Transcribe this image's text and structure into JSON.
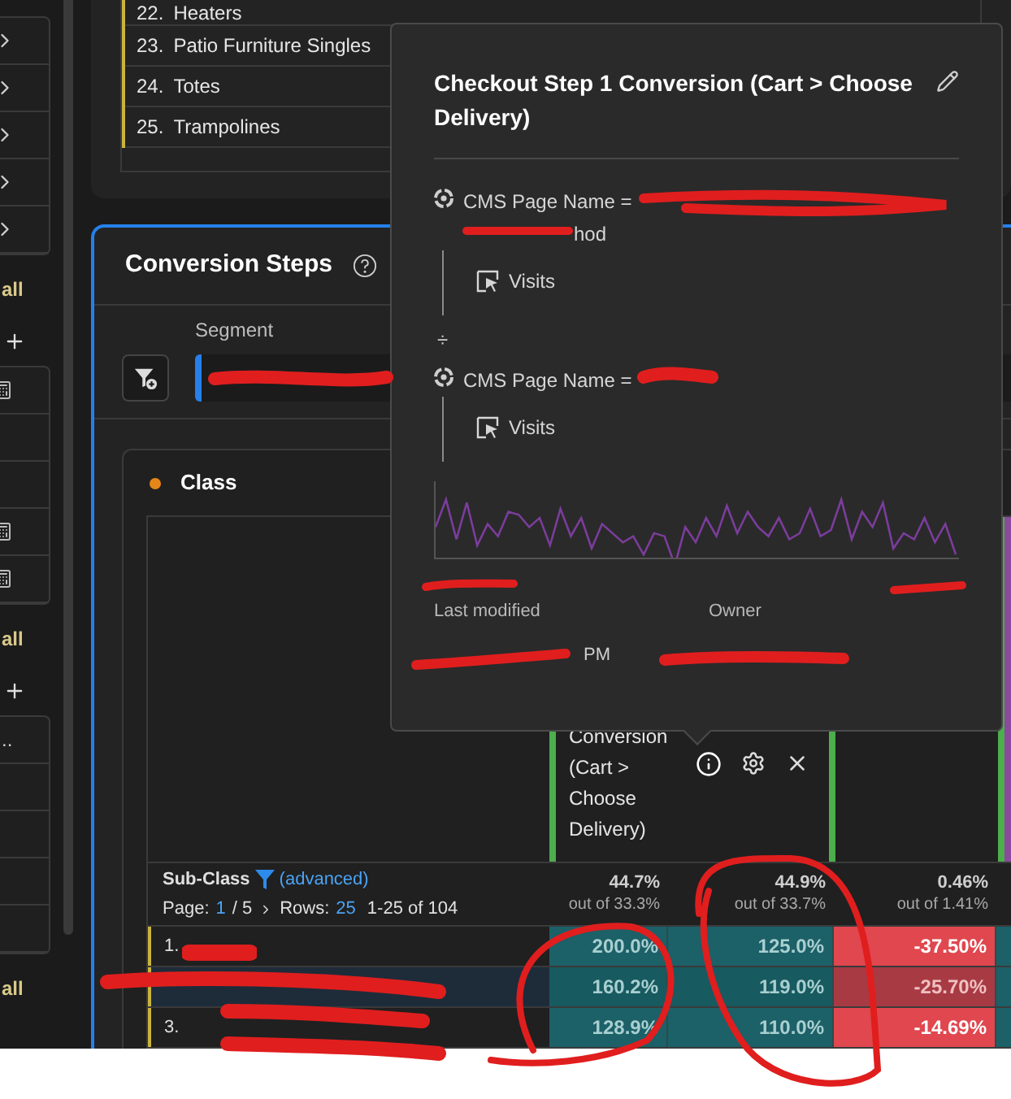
{
  "sidebar": {
    "groups": [
      {
        "rows": [
          {
            "kind": "chevron"
          },
          {
            "kind": "chevron"
          },
          {
            "kind": "chevron"
          },
          {
            "kind": "chevron"
          },
          {
            "kind": "chevron"
          }
        ],
        "link": "all"
      },
      {
        "rows": [
          {
            "kind": "calculator"
          },
          {
            "kind": "blank"
          },
          {
            "kind": "blank"
          },
          {
            "kind": "calculator"
          },
          {
            "kind": "calculator"
          }
        ],
        "link": "all"
      },
      {
        "rows": [
          {
            "kind": "text",
            "text": ".."
          },
          {
            "kind": "blank"
          },
          {
            "kind": "blank"
          },
          {
            "kind": "blank"
          },
          {
            "kind": "blank"
          }
        ],
        "link": "all"
      }
    ]
  },
  "top_list": {
    "rows": [
      {
        "number": "22.",
        "label": "Heaters"
      },
      {
        "number": "23.",
        "label": "Patio Furniture Singles"
      },
      {
        "number": "24.",
        "label": "Totes"
      },
      {
        "number": "25.",
        "label": "Trampolines"
      }
    ]
  },
  "panel": {
    "title": "Conversion Steps",
    "segment_label": "Segment",
    "class_title": "Class"
  },
  "table": {
    "column_header": "Conversion (Cart > Choose Delivery)",
    "sub_class": {
      "title": "Sub-Class",
      "filter": "(advanced)",
      "page_label": "Page:",
      "page": "1",
      "page_total": "/ 5",
      "rows_label": "Rows:",
      "rows": "25",
      "range": "1-25 of 104"
    },
    "totals": [
      {
        "value": "44.7%",
        "of": "out of 33.3%"
      },
      {
        "value": "44.9%",
        "of": "out of 33.7%"
      },
      {
        "value": "0.46%",
        "of": "out of 1.41%"
      }
    ],
    "rows": [
      {
        "label": "1.",
        "selected": false,
        "cells": [
          {
            "text": "200.0%",
            "kind": "positive"
          },
          {
            "text": "125.0%",
            "kind": "positive"
          },
          {
            "text": "-37.50%",
            "kind": "negative"
          }
        ]
      },
      {
        "selected": true,
        "cells": [
          {
            "text": "160.2%",
            "kind": "positive"
          },
          {
            "text": "119.0%",
            "kind": "positive"
          },
          {
            "text": "-25.70%",
            "kind": "negative"
          }
        ]
      },
      {
        "label": "3.",
        "selected": false,
        "cells": [
          {
            "text": "128.9%",
            "kind": "positive"
          },
          {
            "text": "110.0%",
            "kind": "positive"
          },
          {
            "text": "-14.69%",
            "kind": "negative"
          }
        ]
      }
    ]
  },
  "popover": {
    "title": "Checkout Step 1 Conversion (Cart > Choose Delivery)",
    "operands": [
      {
        "dimension": "CMS Page Name =",
        "continuation": "hod",
        "metric": "Visits"
      },
      {
        "dimension": "CMS Page Name =",
        "metric": "Visits"
      }
    ],
    "operator": "÷",
    "modified_label": "Last modified",
    "modified_value": "PM",
    "owner_label": "Owner"
  }
}
